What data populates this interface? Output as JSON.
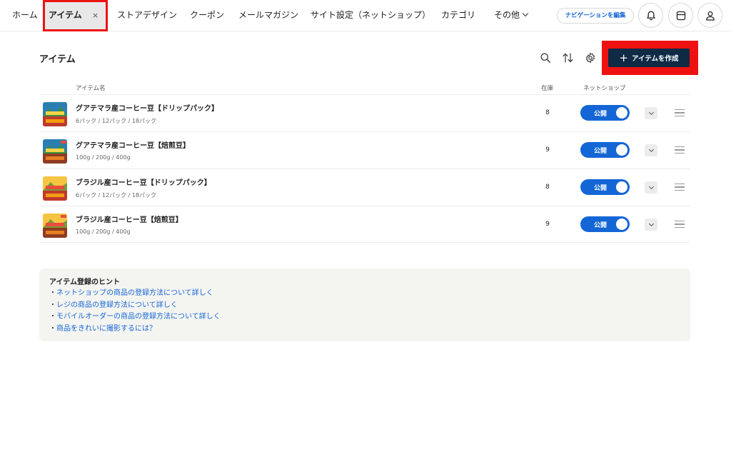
{
  "nav": {
    "items": [
      {
        "label": "ホーム"
      },
      {
        "label": "アイテム",
        "close": "×"
      },
      {
        "label": "ストアデザイン"
      },
      {
        "label": "クーポン"
      },
      {
        "label": "メールマガジン"
      },
      {
        "label": "サイト設定（ネットショップ）"
      },
      {
        "label": "カテゴリ"
      },
      {
        "label": "その他"
      }
    ],
    "edit_nav_label": "ナビゲーションを編集",
    "icons": [
      "bell-icon",
      "storefront-icon",
      "user-icon"
    ]
  },
  "page": {
    "title": "アイテム",
    "create_label": "アイテムを作成",
    "tools": [
      "search-icon",
      "sort-icon",
      "gear-icon"
    ]
  },
  "table": {
    "headers": {
      "name": "アイテム名",
      "stock": "在庫",
      "netshop": "ネットショップ"
    },
    "rows": [
      {
        "name": "グアテマラ産コーヒー豆【ドリップパック】",
        "variants": "6パック / 12パック / 18パック",
        "stock": "8",
        "status": "公開"
      },
      {
        "name": "グアテマラ産コーヒー豆【焙煎豆】",
        "variants": "100g / 200g / 400g",
        "stock": "9",
        "status": "公開"
      },
      {
        "name": "ブラジル産コーヒー豆【ドリップパック】",
        "variants": "6パック / 12パック / 18パック",
        "stock": "8",
        "status": "公開"
      },
      {
        "name": "ブラジル産コーヒー豆【焙煎豆】",
        "variants": "100g / 200g / 400g",
        "stock": "9",
        "status": "公開"
      }
    ]
  },
  "hints": {
    "title": "アイテム登録のヒント",
    "bullet": "・",
    "links": [
      "ネットショップの商品の登録方法について詳しく",
      "レジの商品の登録方法について詳しく",
      "モバイルオーダーの商品の登録方法について詳しく",
      "商品をきれいに撮影するには？"
    ]
  },
  "colors": {
    "accent": "#1466d6",
    "create_bg": "#0e2a45",
    "highlight": "#ee1111"
  }
}
